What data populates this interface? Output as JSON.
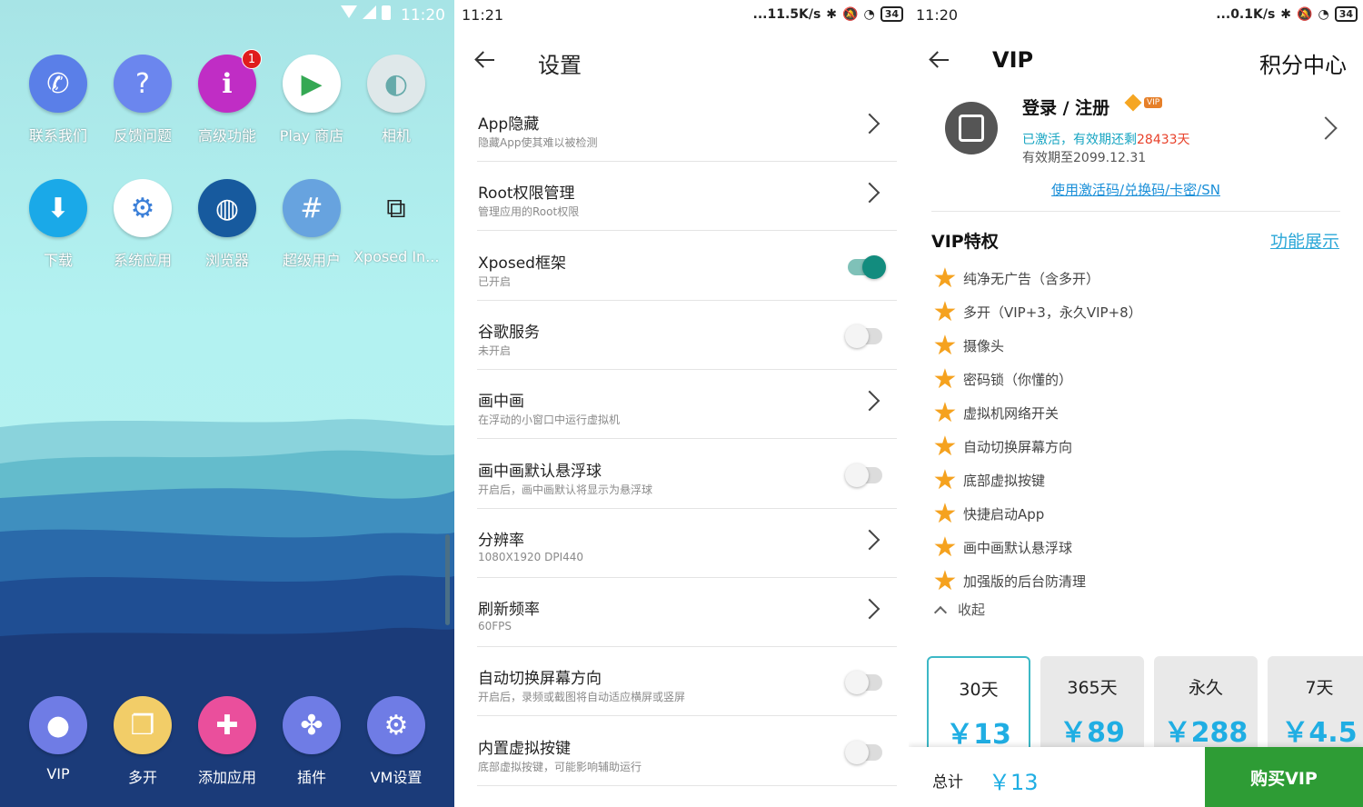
{
  "home": {
    "status": {
      "time": "11:20"
    },
    "apps": [
      {
        "label": "联系我们",
        "icon": "phone-icon",
        "color": "#5a7fe8"
      },
      {
        "label": "反馈问题",
        "icon": "question-icon",
        "color": "#6b86ee"
      },
      {
        "label": "高级功能",
        "icon": "info-book-icon",
        "color": "#c02dc5",
        "badge": "1"
      },
      {
        "label": "Play 商店",
        "icon": "play-store-icon",
        "color": "#ffffff"
      },
      {
        "label": "相机",
        "icon": "camera-icon",
        "color": "#dfe8ea"
      },
      {
        "label": "下载",
        "icon": "download-icon",
        "color": "#1aa9e8"
      },
      {
        "label": "系统应用",
        "icon": "system-apps-icon",
        "color": "#ffffff"
      },
      {
        "label": "浏览器",
        "icon": "globe-icon",
        "color": "#175a9e"
      },
      {
        "label": "超级用户",
        "icon": "hash-icon",
        "color": "#67a3df"
      },
      {
        "label": "Xposed In...",
        "icon": "puzzle-icon",
        "color": "transparent"
      }
    ],
    "dock": [
      {
        "label": "VIP",
        "icon": "user-icon",
        "color": "#6f7ce5"
      },
      {
        "label": "多开",
        "icon": "multi-window-icon",
        "color": "#f2cd68"
      },
      {
        "label": "添加应用",
        "icon": "plus-icon",
        "color": "#ea4f9c"
      },
      {
        "label": "插件",
        "icon": "puzzle-piece-icon",
        "color": "#6f7ce5"
      },
      {
        "label": "VM设置",
        "icon": "gear-icon",
        "color": "#6f7ce5"
      }
    ]
  },
  "settings": {
    "status": {
      "time": "11:21",
      "speed": "...11.5K/s",
      "battery": "34"
    },
    "title": "设置",
    "rows": [
      {
        "title": "App隐藏",
        "sub": "隐藏App使其难以被检测",
        "type": "chevron"
      },
      {
        "title": "Root权限管理",
        "sub": "管理应用的Root权限",
        "type": "chevron"
      },
      {
        "title": "Xposed框架",
        "sub": "已开启",
        "type": "toggle",
        "on": true
      },
      {
        "title": "谷歌服务",
        "sub": "未开启",
        "type": "toggle",
        "on": false
      },
      {
        "title": "画中画",
        "sub": "在浮动的小窗口中运行虚拟机",
        "type": "chevron"
      },
      {
        "title": "画中画默认悬浮球",
        "sub": "开启后，画中画默认将显示为悬浮球",
        "type": "toggle",
        "on": false
      },
      {
        "title": "分辨率",
        "sub": "1080X1920 DPI440",
        "type": "chevron"
      },
      {
        "title": "刷新频率",
        "sub": "60FPS",
        "type": "chevron"
      },
      {
        "title": "自动切换屏幕方向",
        "sub": "开启后，录频或截图将自动适应横屏或竖屏",
        "type": "toggle",
        "on": false
      },
      {
        "title": "内置虚拟按键",
        "sub": "底部虚拟按键，可能影响辅助运行",
        "type": "toggle",
        "on": false
      }
    ]
  },
  "vip": {
    "status": {
      "time": "11:20",
      "speed": "...0.1K/s",
      "battery": "34"
    },
    "title": "VIP",
    "points_center": "积分中心",
    "login": "登录 / 注册",
    "vip_tag": "VIP",
    "activated_prefix": "已激活，有效期还剩",
    "activated_days": "28433天",
    "expiry": "有效期至2099.12.31",
    "code_link": "使用激活码/兑换码/卡密/SN",
    "privileges_title": "VIP特权",
    "show_features": "功能展示",
    "features": [
      "纯净无广告（含多开）",
      "多开（VIP+3，永久VIP+8）",
      "摄像头",
      "密码锁（你懂的）",
      "虚拟机网络开关",
      "自动切换屏幕方向",
      "底部虚拟按键",
      "快捷启动App",
      "画中画默认悬浮球",
      "加强版的后台防清理"
    ],
    "collapse": "收起",
    "plans": [
      {
        "duration": "30天",
        "price": "￥13",
        "selected": true
      },
      {
        "duration": "365天",
        "price": "￥89"
      },
      {
        "duration": "永久",
        "price": "￥288"
      },
      {
        "duration": "7天",
        "price": "￥4.5"
      }
    ],
    "total_label": "总计",
    "total_price": "￥13",
    "buy": "购买VIP"
  }
}
